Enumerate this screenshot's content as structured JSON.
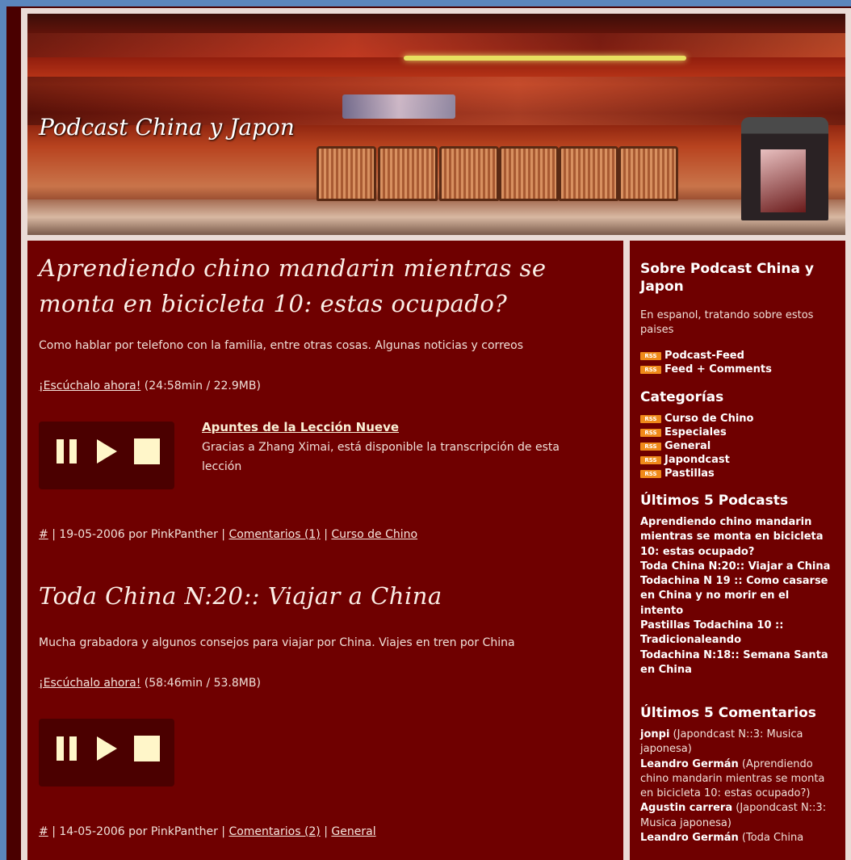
{
  "site_title": "Podcast China y Japon",
  "posts": [
    {
      "title": "Aprendiendo chino mandarin mientras se monta en bicicleta 10: estas ocupado?",
      "description": "Como hablar por telefono con la familia, entre otras cosas. Algunas noticias y correos",
      "listen_label": "¡Escúchalo ahora!",
      "listen_info": "(24:58min / 22.9MB)",
      "notes_title": "Apuntes de la Lección Nueve",
      "notes_text": "Gracias a Zhang Ximai, está disponible la transcripción de esta lección",
      "permalink": "#",
      "meta_text": "| 19-05-2006 por PinkPanther |",
      "comments_label": "Comentarios (1)",
      "meta_sep": "|",
      "category": "Curso de Chino"
    },
    {
      "title": "Toda China N:20:: Viajar a China",
      "description": "Mucha grabadora y algunos consejos para viajar por China. Viajes en tren por China",
      "listen_label": "¡Escúchalo ahora!",
      "listen_info": "(58:46min / 53.8MB)",
      "permalink": "#",
      "meta_text": "| 14-05-2006 por PinkPanther |",
      "comments_label": "Comentarios (2)",
      "meta_sep": "|",
      "category": "General"
    }
  ],
  "sidebar": {
    "about_heading": "Sobre Podcast China y Japon",
    "about_text": "En espanol, tratando sobre estos paises",
    "rss_badge": "RSS",
    "feeds": [
      "Podcast-Feed",
      "Feed + Comments"
    ],
    "categories_heading": "Categorías",
    "categories": [
      "Curso de Chino",
      "Especiales",
      "General",
      "Japondcast",
      "Pastillas"
    ],
    "podcasts_heading": "Últimos 5 Podcasts",
    "podcasts": [
      "Aprendiendo chino mandarin mientras se monta en bicicleta 10: estas ocupado?",
      "Toda China N:20:: Viajar a China",
      "Todachina N 19 :: Como casarse en China y no morir en el intento",
      "Pastillas Todachina 10 :: Tradicionaleando",
      "Todachina N:18:: Semana Santa en China"
    ],
    "comments_heading": "Últimos 5 Comentarios",
    "comments": [
      {
        "author": "jonpi",
        "post": "(Japondcast N::3: Musica japonesa)"
      },
      {
        "author": "Leandro Germán",
        "post": "(Aprendiendo chino mandarin mientras se monta en bicicleta 10: estas ocupado?)"
      },
      {
        "author": "Agustin carrera",
        "post": "(Japondcast N::3: Musica japonesa)"
      },
      {
        "author": "Leandro Germán",
        "post": "(Toda China"
      }
    ]
  },
  "colors": {
    "page_bg": "#5b86bd",
    "content_bg": "#6f0000",
    "player_bg": "#4b0000",
    "player_icons": "#fff6c9",
    "rss_badge": "#f08a1a"
  }
}
